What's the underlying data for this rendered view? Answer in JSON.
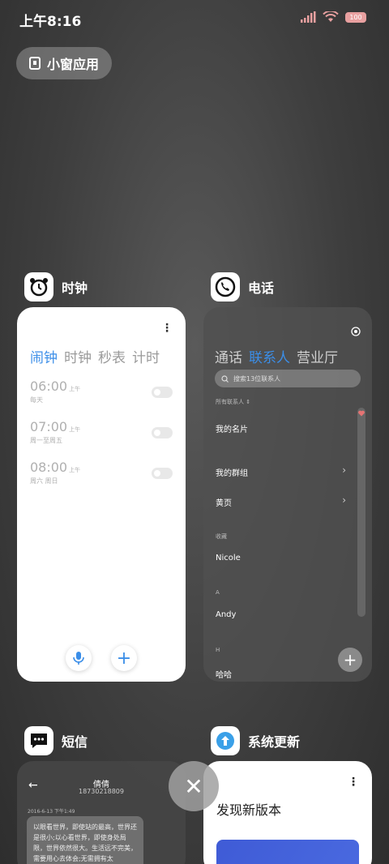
{
  "status": {
    "time": "上午8:16",
    "battery": "100"
  },
  "floating": {
    "label": "小窗应用"
  },
  "apps": {
    "clock": {
      "name": "时钟",
      "tabs": [
        "闹钟",
        "时钟",
        "秒表",
        "计时"
      ],
      "alarms": [
        {
          "time": "06:00",
          "ampm": "上午",
          "repeat": "每天"
        },
        {
          "time": "07:00",
          "ampm": "上午",
          "repeat": "周一至周五"
        },
        {
          "time": "08:00",
          "ampm": "上午",
          "repeat": "周六 周日"
        }
      ]
    },
    "phone": {
      "name": "电话",
      "tabs": [
        "通话",
        "联系人",
        "营业厅"
      ],
      "search_placeholder": "搜索13位联系人",
      "filter": "所有联系人",
      "my_card": "我的名片",
      "my_groups": "我的群组",
      "yellow_pages": "黄页",
      "section_recent": "收藏",
      "contacts": [
        "Nicole",
        "Andy",
        "哈哈"
      ],
      "section_a": "A",
      "section_h": "H"
    },
    "sms": {
      "name": "短信",
      "contact_name": "倩倩",
      "contact_number": "18730218809",
      "date": "2016-6-13 下午1:49",
      "message": "以眼看世界，即使站的最高，世界还是很小;以心看世界，即使身处局限，世界依然很大。生活远不完美，需要用心去体会;无需拥有太"
    },
    "update": {
      "name": "系统更新",
      "heading": "发现新版本"
    }
  }
}
